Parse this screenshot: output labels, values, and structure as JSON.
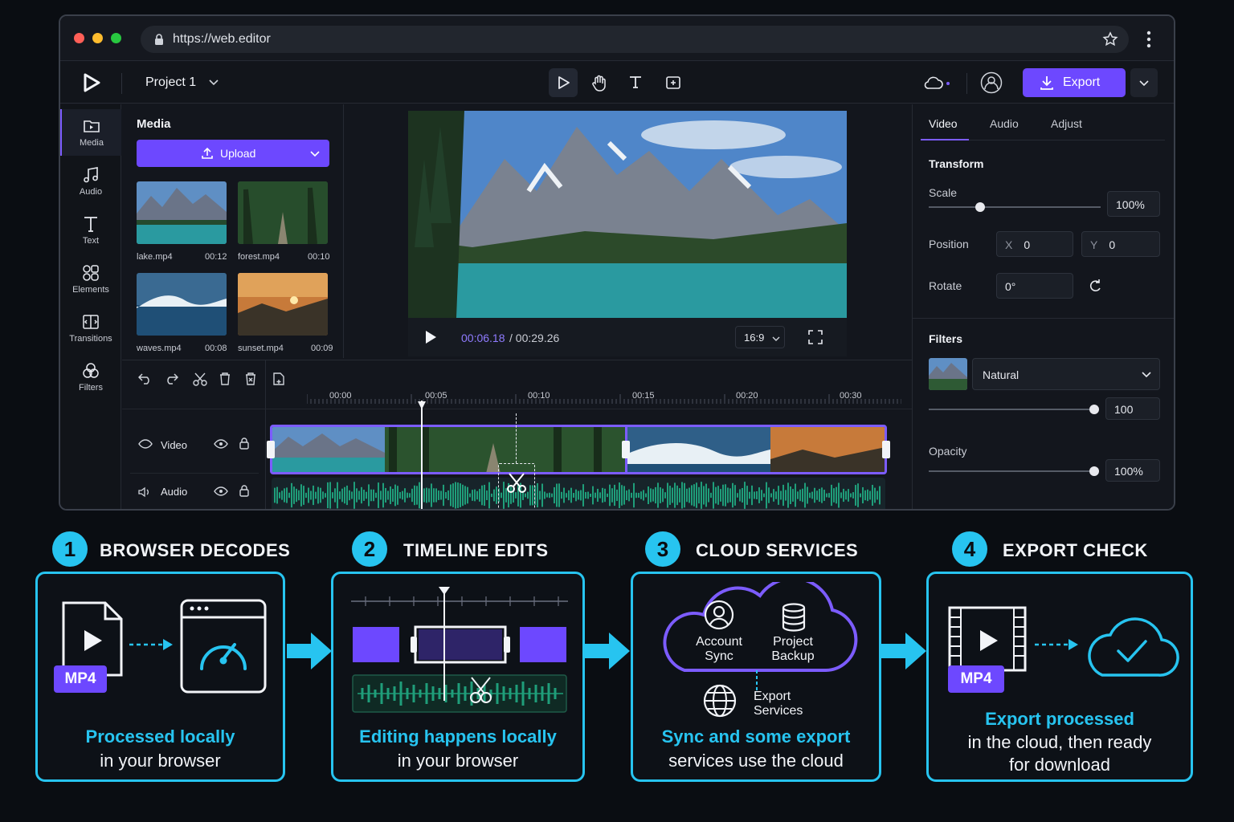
{
  "browser": {
    "url": "https://web.editor"
  },
  "header": {
    "project": "Project 1",
    "export_label": "Export"
  },
  "sidebar": {
    "items": [
      {
        "label": "Media"
      },
      {
        "label": "Audio"
      },
      {
        "label": "Text"
      },
      {
        "label": "Elements"
      },
      {
        "label": "Transitions"
      },
      {
        "label": "Filters"
      }
    ]
  },
  "media": {
    "title": "Media",
    "upload_label": "Upload",
    "files": [
      {
        "name": "lake.mp4",
        "duration": "00:12"
      },
      {
        "name": "forest.mp4",
        "duration": "00:10"
      },
      {
        "name": "waves.mp4",
        "duration": "00:08"
      },
      {
        "name": "sunset.mp4",
        "duration": "00:09"
      }
    ]
  },
  "player": {
    "current_time": "00:06.18",
    "total_time": "/ 00:29.26",
    "aspect": "16:9"
  },
  "timeline": {
    "ruler": [
      "00:00",
      "00:05",
      "00:10",
      "00:15",
      "00:20",
      "00:30"
    ],
    "tracks": [
      {
        "label": "Video"
      },
      {
        "label": "Audio"
      }
    ]
  },
  "inspector": {
    "tabs": [
      "Video",
      "Audio",
      "Adjust"
    ],
    "transform_title": "Transform",
    "scale_label": "Scale",
    "scale_value": "100%",
    "scale_level": 0.3,
    "position_label": "Position",
    "x_label": "X",
    "x_value": "0",
    "y_label": "Y",
    "y_value": "0",
    "rotate_label": "Rotate",
    "rotate_value": "0°",
    "filters_title": "Filters",
    "filter_name": "Natural",
    "filter_value": "100",
    "filter_level": 1.0,
    "opacity_label": "Opacity",
    "opacity_value": "100%",
    "opacity_level": 1.0
  },
  "steps": [
    {
      "num": "1",
      "title": "BROWSER DECODES",
      "line1": "Processed locally",
      "line2": "in your browser",
      "badge": "MP4"
    },
    {
      "num": "2",
      "title": "TIMELINE EDITS",
      "line1": "Editing happens locally",
      "line2": "in your browser"
    },
    {
      "num": "3",
      "title": "CLOUD SERVICES",
      "line1": "Sync and some export",
      "line2": "services use the cloud",
      "account_sync": "Account\nSync",
      "project_backup": "Project\nBackup",
      "export_services": "Export\nServices"
    },
    {
      "num": "4",
      "title": "EXPORT CHECK",
      "line1": "Export processed",
      "line2": "in the cloud, then ready",
      "line3": "for download",
      "badge": "MP4"
    }
  ],
  "colors": {
    "accent": "#7c5cff",
    "cyan": "#27c4f0",
    "lake": "#2a9aa0",
    "wave": "#1f9e7a"
  }
}
